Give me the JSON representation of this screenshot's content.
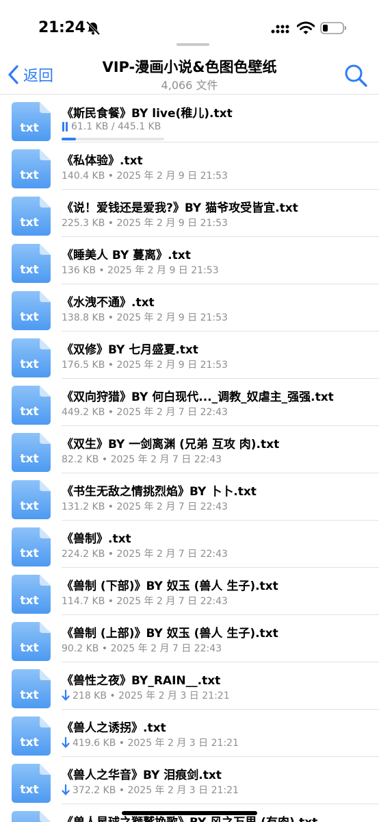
{
  "status": {
    "time": "21:24"
  },
  "nav": {
    "back_label": "返回",
    "title": "VIP-漫画小说&色图色壁纸",
    "subtitle": "4,066 文件"
  },
  "icon_label": "txt",
  "colors": {
    "accent": "#2f7cf6",
    "icon_light": "#8dc2f8",
    "icon_dark": "#4d9af2",
    "secondary_text": "#8e8e93"
  },
  "files": [
    {
      "name": "《斯民食餐》BY live(稚儿).txt",
      "meta": "61.1 KB / 445.1 KB",
      "state": "downloading-paused",
      "progress": 0.14
    },
    {
      "name": "《私体验》.txt",
      "meta": "140.4 KB • 2025 年 2 月 9 日 21:53",
      "state": "local"
    },
    {
      "name": "《说！爱钱还是爱我?》BY 猫爷攻受皆宜.txt",
      "meta": "225.3 KB • 2025 年 2 月 9 日 21:53",
      "state": "local"
    },
    {
      "name": "《睡美人 BY 蔓离》.txt",
      "meta": "136 KB • 2025 年 2 月 9 日 21:53",
      "state": "local"
    },
    {
      "name": "《水洩不通》.txt",
      "meta": "138.8 KB • 2025 年 2 月 9 日 21:53",
      "state": "local"
    },
    {
      "name": "《双修》BY 七月盛夏.txt",
      "meta": "176.5 KB • 2025 年 2 月 9 日 21:53",
      "state": "local"
    },
    {
      "name": "《双向狩猎》BY 何白现代..._调教_奴虐主_强强.txt",
      "meta": "449.2 KB • 2025 年 2 月 7 日 22:43",
      "state": "local"
    },
    {
      "name": "《双生》BY 一剑离渊 (兄弟 互攻 肉).txt",
      "meta": "82.2 KB • 2025 年 2 月 7 日 22:43",
      "state": "local"
    },
    {
      "name": "《书生无敌之情挑烈焰》BY 卜卜.txt",
      "meta": "131.2 KB • 2025 年 2 月 7 日 22:43",
      "state": "local"
    },
    {
      "name": "《兽制》.txt",
      "meta": "224.2 KB • 2025 年 2 月 7 日 22:43",
      "state": "local"
    },
    {
      "name": "《兽制 (下部)》BY 奴玉 (兽人 生子).txt",
      "meta": "114.7 KB • 2025 年 2 月 7 日 22:43",
      "state": "local"
    },
    {
      "name": "《兽制 (上部)》BY 奴玉 (兽人 生子).txt",
      "meta": "90.2 KB • 2025 年 2 月 7 日 22:43",
      "state": "local"
    },
    {
      "name": "《兽性之夜》BY_RAIN__.txt",
      "meta": "218 KB • 2025 年 2 月 3 日 21:21",
      "state": "cloud"
    },
    {
      "name": "《兽人之诱拐》.txt",
      "meta": "419.6 KB • 2025 年 2 月 3 日 21:21",
      "state": "cloud"
    },
    {
      "name": "《兽人之华音》BY 泪痕剑.txt",
      "meta": "372.2 KB • 2025 年 2 月 3 日 21:21",
      "state": "cloud"
    },
    {
      "name": "《兽人星球之獅鹫挽歌》BY 风之万里 (有肉).txt",
      "meta": "",
      "state": "cloud"
    }
  ]
}
